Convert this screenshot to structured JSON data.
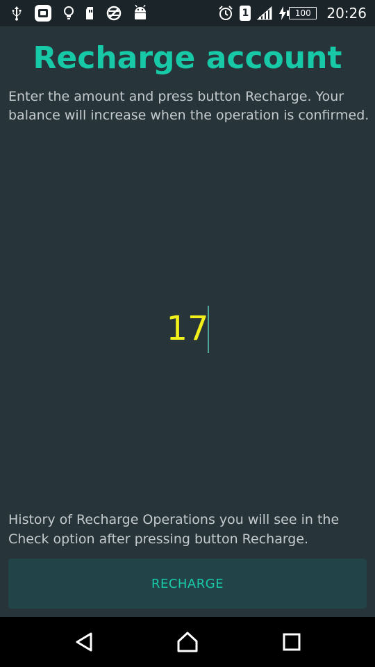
{
  "status_bar": {
    "left_icons": [
      "usb-icon",
      "app-badge-icon",
      "lightbulb-icon",
      "sd-card-icon",
      "no-network-icon",
      "android-icon"
    ],
    "right_icons": [
      "alarm-icon",
      "sim-icon",
      "signal-icon",
      "charging-icon"
    ],
    "sim_number": "1",
    "battery_level": "100",
    "time": "20:26"
  },
  "header": {
    "title": "Recharge account"
  },
  "content": {
    "instructions": "Enter the amount and press button Recharge. Your balance will increase when the operation is confirmed.",
    "amount_value": "17",
    "history_note": "History of Recharge Operations you will see in the Check option after pressing button Recharge."
  },
  "actions": {
    "recharge_label": "RECHARGE"
  },
  "nav_bar": {
    "icons": [
      "back-icon",
      "home-icon",
      "recents-icon"
    ]
  },
  "colors": {
    "background": "#27343a",
    "status_bar": "#1b2428",
    "accent": "#18c9a8",
    "amount_text": "#f2f01a",
    "body_text": "#c4cbce",
    "button_bg": "#224449",
    "nav_bar": "#000000"
  }
}
